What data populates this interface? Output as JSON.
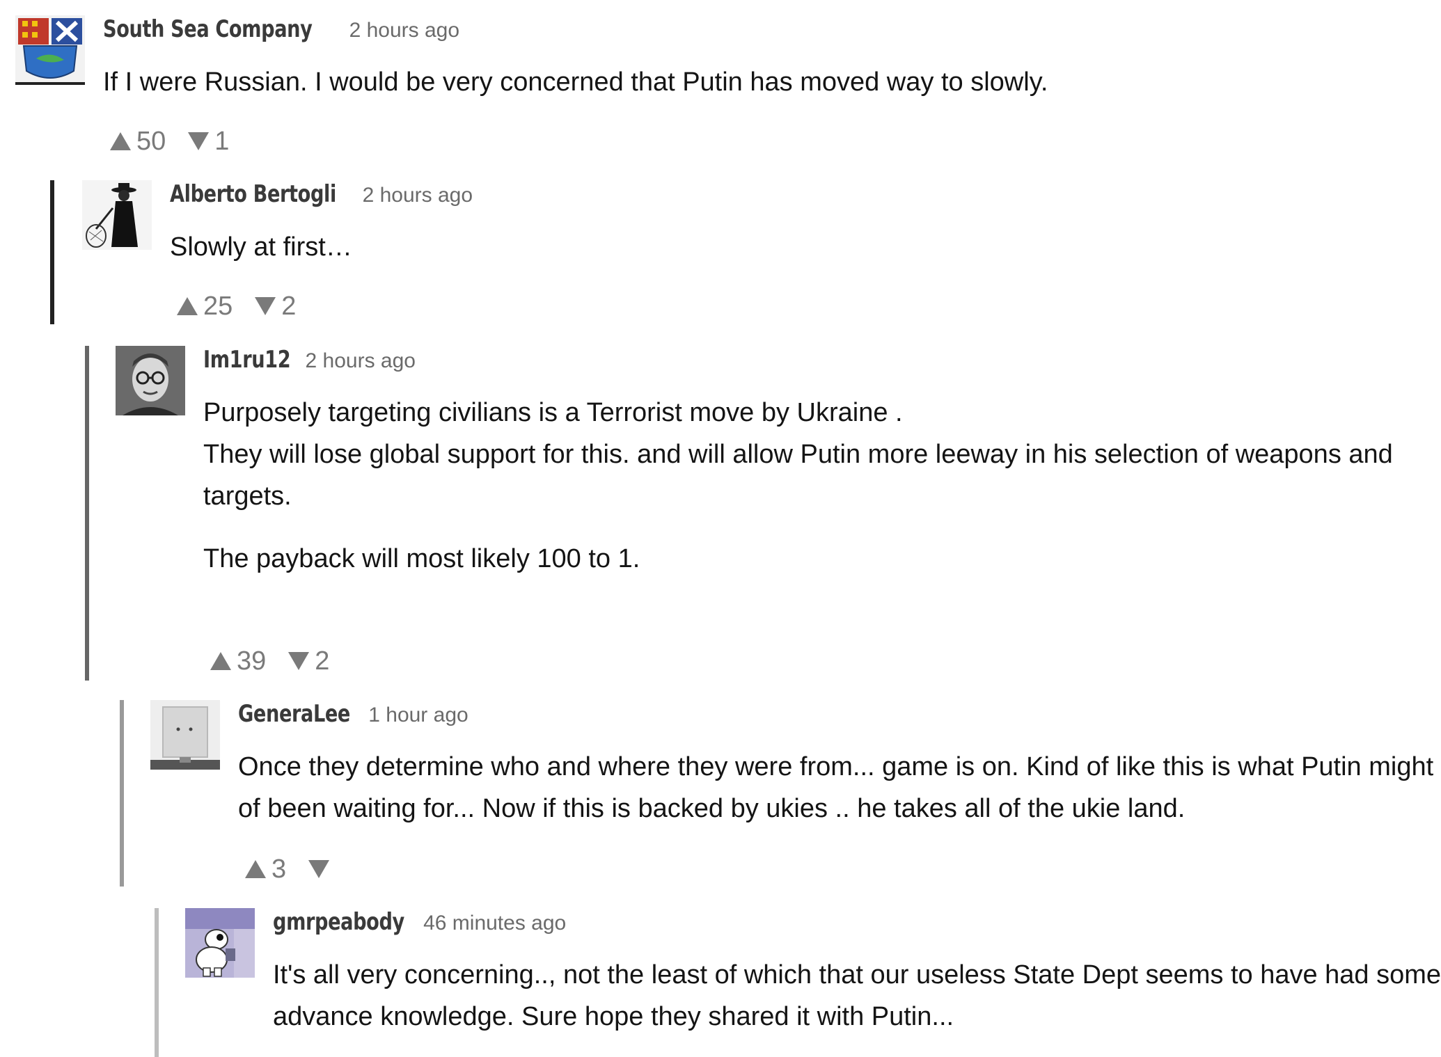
{
  "comments": [
    {
      "username": "South Sea Company",
      "timestamp": "2 hours ago",
      "paragraphs": [
        "If I were Russian. I would be very concerned that Putin has moved way to slowly."
      ],
      "upvotes": "50",
      "downvotes": "1"
    },
    {
      "username": "Alberto Bertogli",
      "timestamp": "2 hours ago",
      "paragraphs": [
        "Slowly at first…"
      ],
      "upvotes": "25",
      "downvotes": "2"
    },
    {
      "username": "Im1ru12",
      "timestamp": "2 hours ago",
      "paragraphs": [
        "Purposely targeting civilians is a Terrorist move by Ukraine .",
        "They will lose global support for this. and will allow Putin more leeway in his selection of weapons and targets.",
        "The payback will most likely 100 to 1."
      ],
      "upvotes": "39",
      "downvotes": "2"
    },
    {
      "username": "GeneraLee",
      "timestamp": "1 hour ago",
      "paragraphs": [
        "Once they determine who and where they were from... game is on. Kind of like this is what Putin might of been waiting for... Now if this is backed by ukies .. he takes all of the ukie land."
      ],
      "upvotes": "3",
      "downvotes": ""
    },
    {
      "username": "gmrpeabody",
      "timestamp": "46 minutes ago",
      "paragraphs": [
        "It's all very concerning.., not the least of which that our useless State Dept seems to have had some advance knowledge. Sure hope they shared it with Putin..."
      ]
    }
  ],
  "colors": {
    "thread_line_1": "#222222",
    "thread_line_2": "#666666",
    "thread_line_3": "#9a9a9a",
    "thread_line_4": "#bdbdbd",
    "vote_gray": "#7a7a7a"
  }
}
